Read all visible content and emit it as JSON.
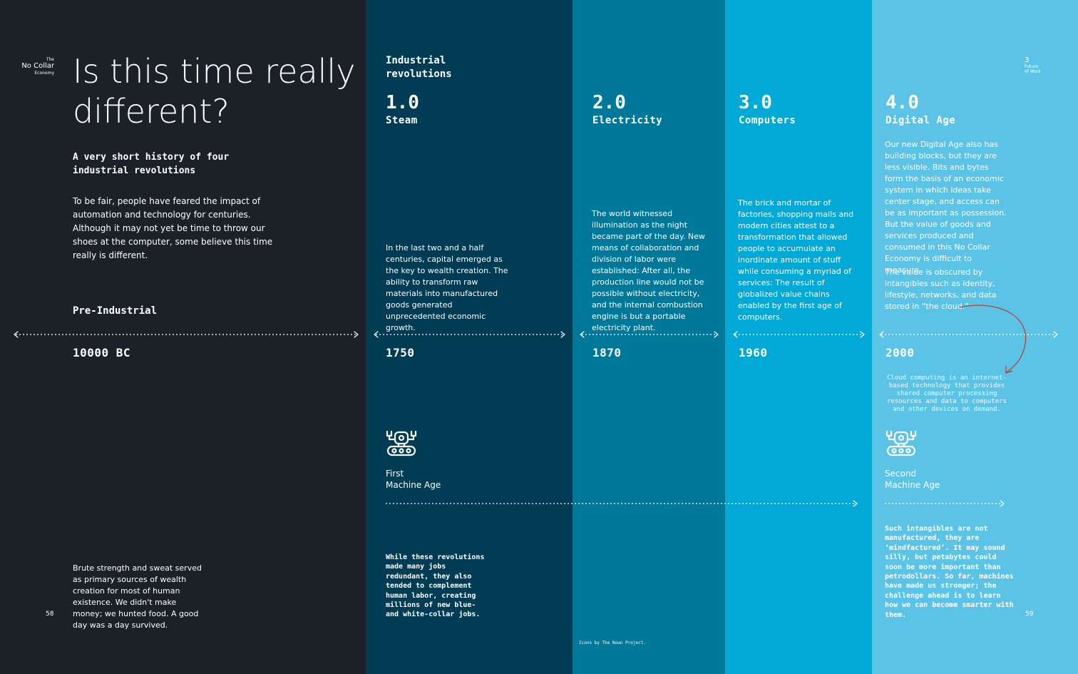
{
  "brand": {
    "small": "The",
    "main": "No Collar",
    "sub": "Economy"
  },
  "chapter": {
    "number": "3",
    "line1": "Future",
    "line2": "of Work"
  },
  "title": "Is this time really different?",
  "subtitle": "A very short history of four industrial revolutions",
  "intro": "To be fair, people have feared the impact of automation and technology for centuries. Although it may not yet be time to throw our shoes at the computer, some believe this time really is different.",
  "industrial_heading": "Industrial\nrevolutions",
  "colors": {
    "col0": "#1b2126",
    "col1": "#003c54",
    "col2": "#007899",
    "col3": "#00a9d6",
    "col4": "#5bc3e5",
    "callout_arrow": "#c0392b"
  },
  "columns": [
    {
      "id": "pre",
      "era": "Pre-Industrial",
      "year": "10000 BC",
      "text": "Brute strength and sweat served as primary sources of wealth creation for most of human existence. We didn't make money; we hunted food. A good day was a day survived."
    },
    {
      "id": "steam",
      "number": "1.0",
      "era": "Steam",
      "year": "1750",
      "text": "In the last two and a half centuries, capital emerged as the key to wealth creation. The ability to transform raw materials into manufactured goods generated unprecedented economic growth."
    },
    {
      "id": "electricity",
      "number": "2.0",
      "era": "Electricity",
      "year": "1870",
      "text": "The world witnessed illumination as the night became part of the day. New means of collaboration and division of labor were established: After all, the production line would not be possible without electricity, and the internal combustion engine is but a portable electricity plant."
    },
    {
      "id": "computers",
      "number": "3.0",
      "era": "Computers",
      "year": "1960",
      "text": "The brick and mortar of factories, shopping malls and modern cities attest to a transformation that allowed people to accumulate an inordinate amount of stuff while consuming a myriad of services: The result of globalized value chains enabled by the first age of computers."
    },
    {
      "id": "digital",
      "number": "4.0",
      "era": "Digital Age",
      "year": "2000",
      "text": "Our new Digital Age also has building blocks, but they are less visible. Bits and bytes form the basis of an economic system in which ideas take center stage, and access can be as important as possession. But the value of goods and services produced and consumed in this No Collar Economy is difficult to measure.",
      "text2": "The value is obscured by intangibles such as identity, lifestyle, networks, and data stored in “the cloud.”"
    }
  ],
  "cloud_note": "Cloud computing is an internet-based technology that provides shared computer processing resources and data to computers and other devices on demand.",
  "machine_ages": [
    {
      "label": "First\nMachine Age",
      "icon": "robot-icon",
      "text": "While these revolutions made many jobs redundant, they also tended to complement human labor, creating millions of new blue- and white-collar jobs."
    },
    {
      "label": "Second\nMachine Age",
      "icon": "robot-icon",
      "text": "Such intangibles are not manufactured, they are ‘mindfactured’. It may sound silly, but petabytes could soon be more important than petrodollars. So far, machines have made us stronger; the challenge ahead is to learn how we can become smarter with them."
    }
  ],
  "credit": "Icons by The Noun Project.",
  "page_numbers": {
    "left": "58",
    "right": "59"
  }
}
